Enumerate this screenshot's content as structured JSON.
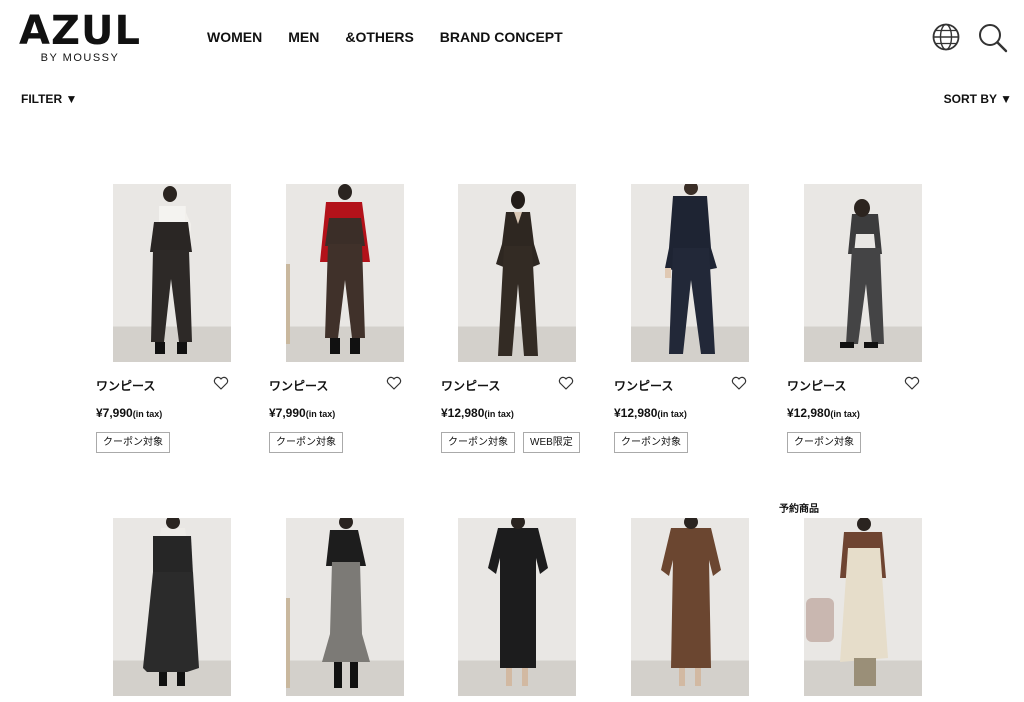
{
  "brand": {
    "name": "AZUL",
    "sub": "BY MOUSSY"
  },
  "nav": [
    "WOMEN",
    "MEN",
    "&OTHERS",
    "BRAND CONCEPT"
  ],
  "header_icons": [
    "globe-icon",
    "search-icon"
  ],
  "toolbar": {
    "filter_label": "FILTER ▼",
    "sort_label": "SORT BY ▼"
  },
  "products": [
    {
      "name": "ワンピース",
      "price": "¥7,990",
      "tax": "(in tax)",
      "badges": [
        "クーポン対象"
      ],
      "image": "black-cami-top-and-wide-pants-outfit"
    },
    {
      "name": "ワンピース",
      "price": "¥7,990",
      "tax": "(in tax)",
      "badges": [
        "クーポン対象"
      ],
      "image": "brown-cami-top-and-wide-pants-outfit"
    },
    {
      "name": "ワンピース",
      "price": "¥12,980",
      "tax": "(in tax)",
      "badges": [
        "クーポン対象",
        "WEB限定"
      ],
      "image": "dark-brown-sleeveless-jumpsuit"
    },
    {
      "name": "ワンピース",
      "price": "¥12,980",
      "tax": "(in tax)",
      "badges": [
        "クーポン対象"
      ],
      "image": "navy-sleeveless-jumpsuit"
    },
    {
      "name": "ワンピース",
      "price": "¥12,980",
      "tax": "(in tax)",
      "badges": [
        "クーポン対象"
      ],
      "image": "charcoal-sleeveless-jumpsuit"
    },
    {
      "image": "black-leather-mermaid-dress"
    },
    {
      "image": "grey-tweed-mermaid-skirt-dress"
    },
    {
      "image": "black-twist-front-midi-dress"
    },
    {
      "image": "brown-puff-sleeve-midi-dress"
    },
    {
      "image": "lace-layered-dress"
    }
  ],
  "preorder_label": "予約商品",
  "colors": {
    "text": "#111111",
    "badge_border": "#aaaaaa",
    "photo_bg": "#e9e7e4"
  }
}
